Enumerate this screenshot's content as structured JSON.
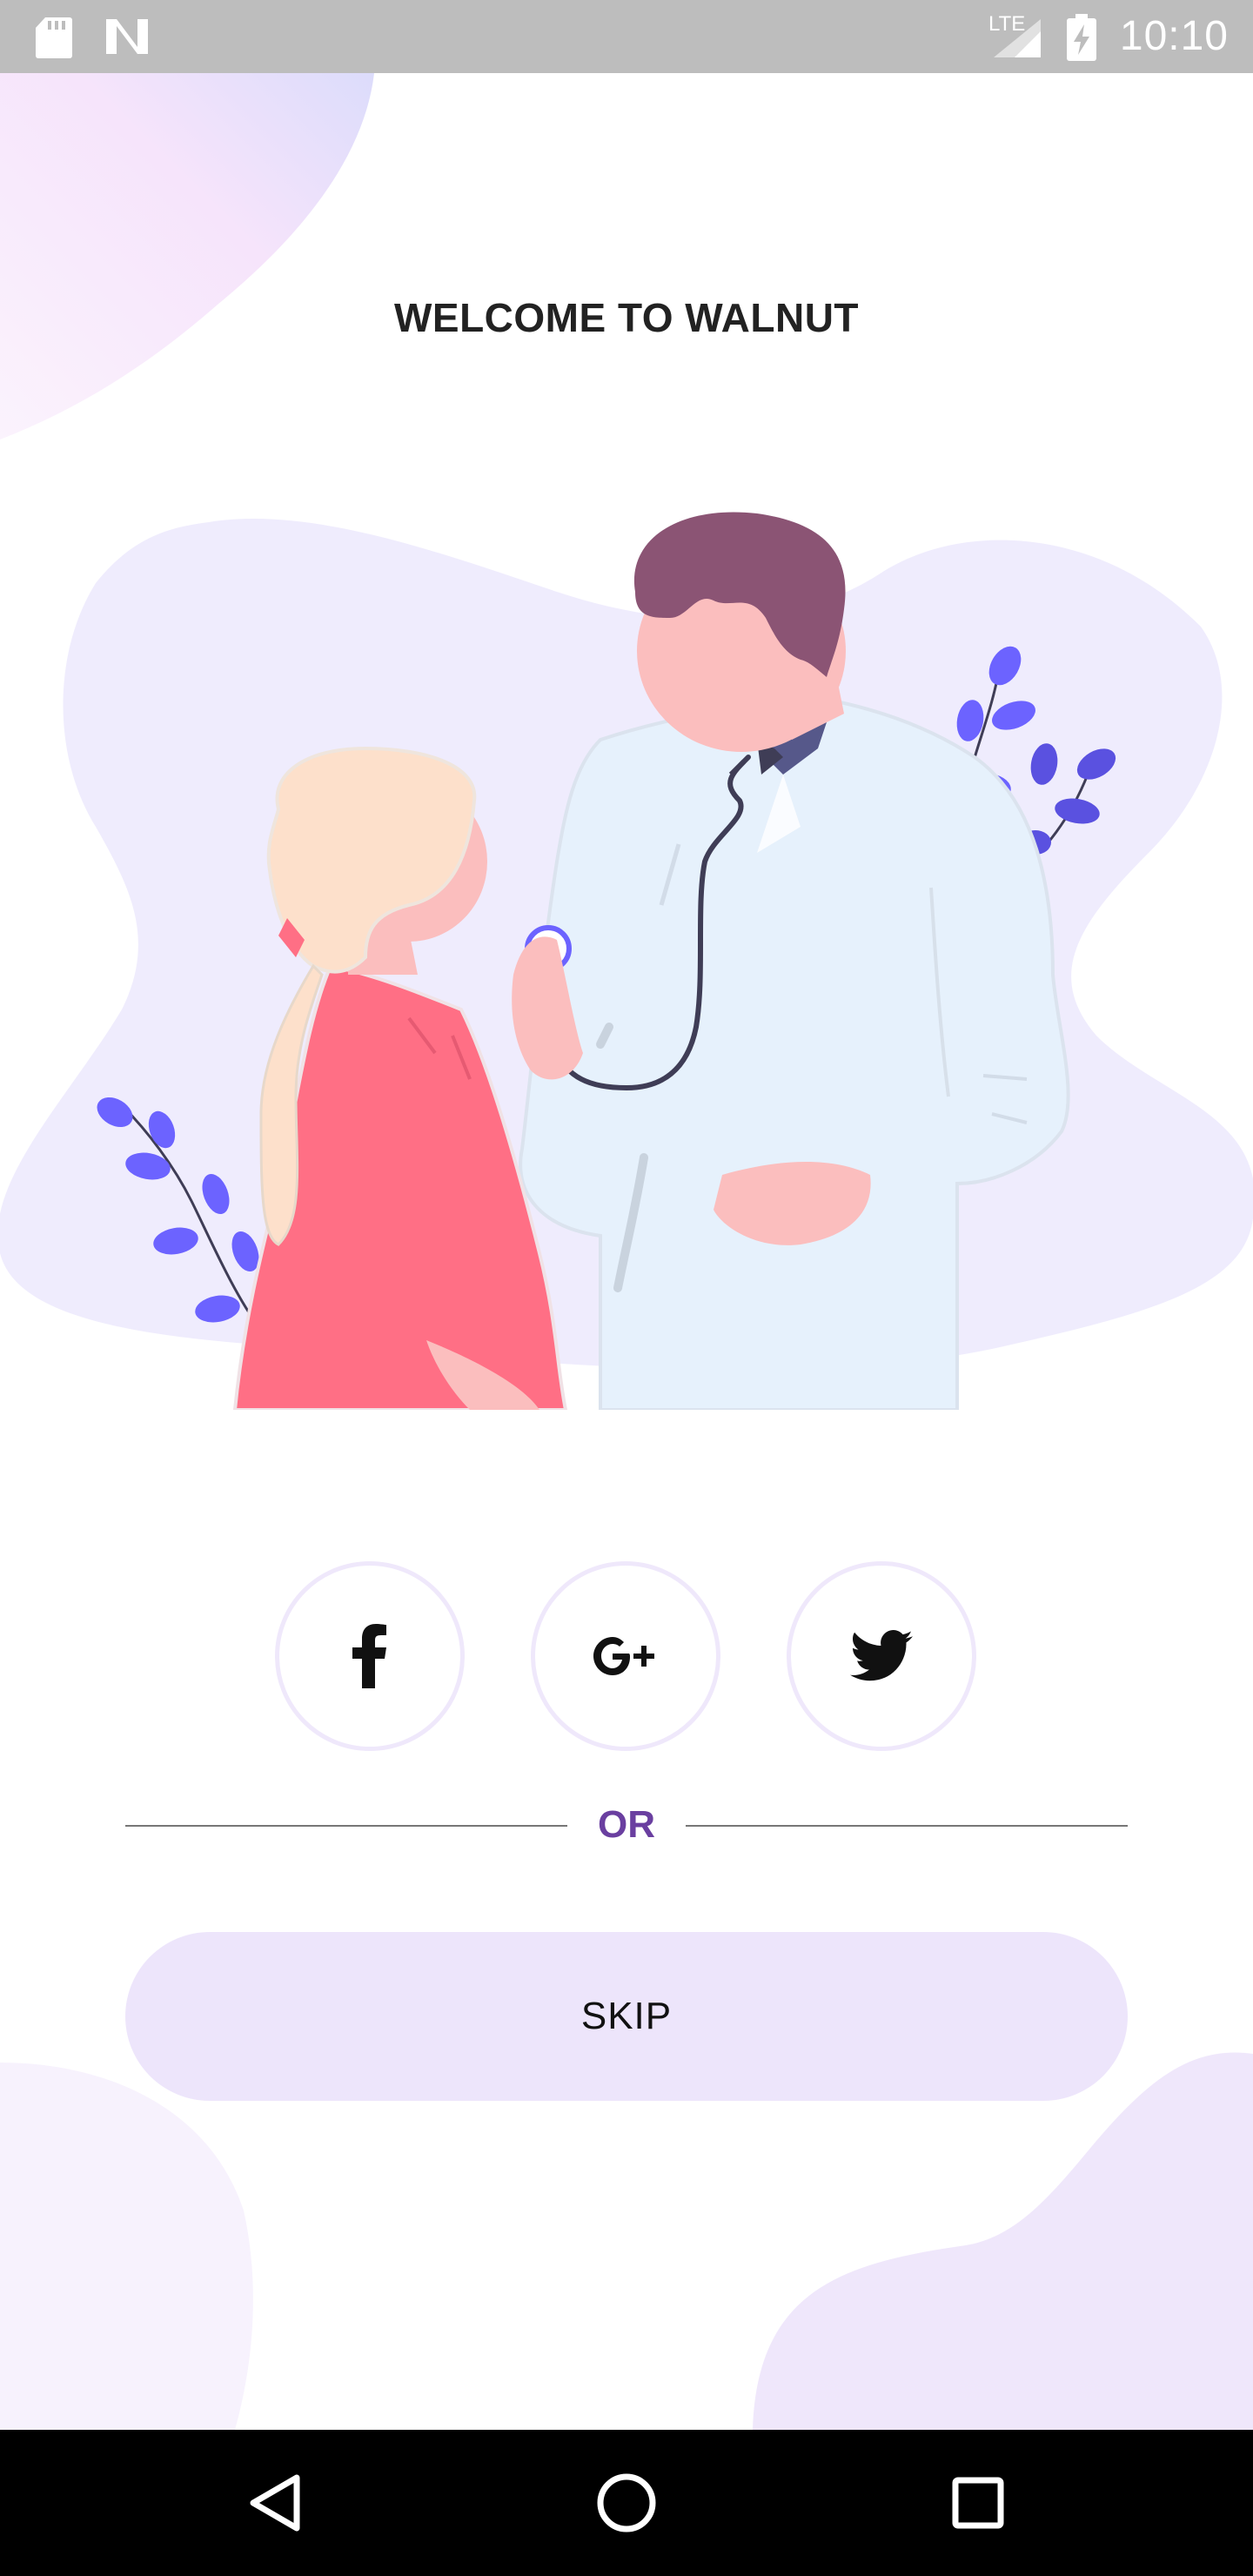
{
  "status_bar": {
    "time": "10:10",
    "network_label": "LTE",
    "icons": [
      "sd-card-icon",
      "notification-n-icon",
      "signal-icon",
      "battery-charging-icon"
    ]
  },
  "welcome": {
    "title": "WELCOME TO WALNUT"
  },
  "social": {
    "buttons": [
      {
        "name": "facebook",
        "icon": "facebook-icon"
      },
      {
        "name": "google-plus",
        "icon": "google-plus-icon"
      },
      {
        "name": "twitter",
        "icon": "twitter-icon"
      }
    ]
  },
  "divider": {
    "or_label": "OR"
  },
  "skip": {
    "label": "SKIP"
  },
  "nav_bar": {
    "icons": [
      "back-icon",
      "home-icon",
      "recents-icon"
    ]
  },
  "colors": {
    "accent_purple": "#6a3fa0",
    "skip_bg": "#ede5fb",
    "social_ring": "#efe8fb",
    "blob_bg": "#f0ecfc",
    "leaf_purple": "#6c63ff"
  }
}
